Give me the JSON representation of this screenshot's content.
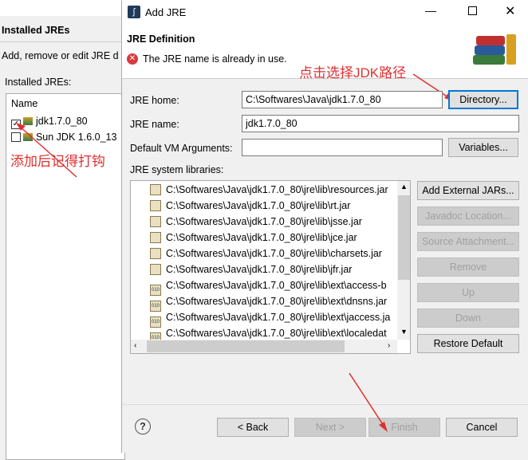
{
  "background": {
    "title": "Installed JREs",
    "description": "Add, remove or edit JRE d",
    "list_label": "Installed JREs:",
    "column_name": "Name",
    "rows": [
      {
        "name": "jdk1.7.0_80",
        "checked": true
      },
      {
        "name": "Sun JDK 1.6.0_13",
        "checked": false
      }
    ]
  },
  "dialog": {
    "title": "Add JRE",
    "header_title": "JRE Definition",
    "error_message": "The JRE name is already in use.",
    "jre_home_label": "JRE home:",
    "jre_home_value": "C:\\Softwares\\Java\\jdk1.7.0_80",
    "directory_button": "Directory...",
    "jre_name_label": "JRE name:",
    "jre_name_value": "jdk1.7.0_80",
    "vm_args_label": "Default VM Arguments:",
    "vm_args_value": "",
    "variables_button": "Variables...",
    "libraries_label": "JRE system libraries:",
    "libraries": [
      "C:\\Softwares\\Java\\jdk1.7.0_80\\jre\\lib\\resources.jar",
      "C:\\Softwares\\Java\\jdk1.7.0_80\\jre\\lib\\rt.jar",
      "C:\\Softwares\\Java\\jdk1.7.0_80\\jre\\lib\\jsse.jar",
      "C:\\Softwares\\Java\\jdk1.7.0_80\\jre\\lib\\jce.jar",
      "C:\\Softwares\\Java\\jdk1.7.0_80\\jre\\lib\\charsets.jar",
      "C:\\Softwares\\Java\\jdk1.7.0_80\\jre\\lib\\jfr.jar",
      "C:\\Softwares\\Java\\jdk1.7.0_80\\jre\\lib\\ext\\access-b",
      "C:\\Softwares\\Java\\jdk1.7.0_80\\jre\\lib\\ext\\dnsns.jar",
      "C:\\Softwares\\Java\\jdk1.7.0_80\\jre\\lib\\ext\\jaccess.ja",
      "C:\\Softwares\\Java\\jdk1.7.0_80\\jre\\lib\\ext\\localedat"
    ],
    "side_buttons": {
      "add_external": "Add External JARs...",
      "javadoc": "Javadoc Location...",
      "source": "Source Attachment...",
      "remove": "Remove",
      "up": "Up",
      "down": "Down",
      "restore": "Restore Default"
    },
    "footer": {
      "back": "< Back",
      "next": "Next >",
      "finish": "Finish",
      "cancel": "Cancel"
    }
  },
  "annotations": {
    "select_jdk": "点击选择JDK路径",
    "check_after_add": "添加后记得打钩"
  },
  "colors": {
    "annotation": "#e03030",
    "accent": "#0078d7",
    "error": "#d83b3b"
  }
}
